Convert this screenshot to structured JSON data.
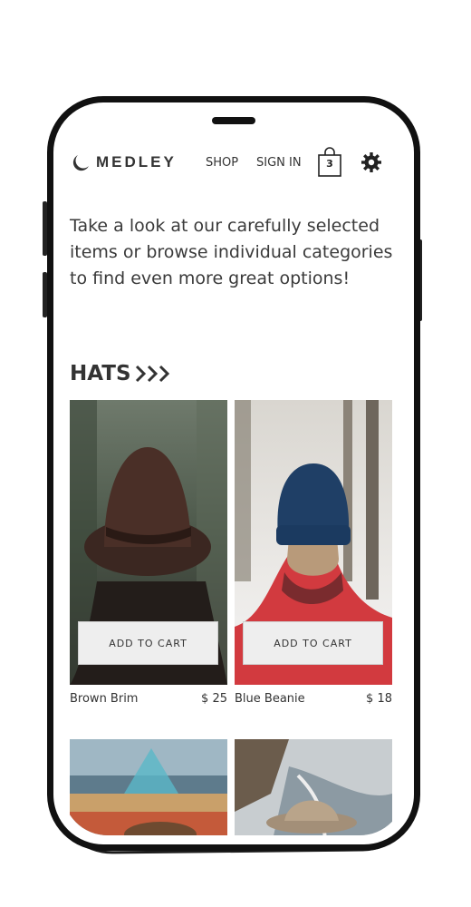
{
  "header": {
    "brand": "MEDLEY",
    "nav_shop": "SHOP",
    "nav_signin": "SIGN IN",
    "cart_count": "3"
  },
  "intro_text": "Take a look at our carefully selected items or browse individual categories to find even more great options!",
  "section": {
    "title": "HATS"
  },
  "products": [
    {
      "name": "Brown Brim",
      "price": "$ 25",
      "button": "ADD TO CART"
    },
    {
      "name": "Blue Beanie",
      "price": "$ 18",
      "button": "ADD TO CART"
    }
  ],
  "icons": {
    "logo": "logo-crescent-icon",
    "cart": "shopping-bag-icon",
    "settings": "gear-icon",
    "section_arrows": "chevron-right-icon"
  },
  "colors": {
    "text": "#333333",
    "button_bg": "#eeeeee",
    "frame": "#111111"
  }
}
